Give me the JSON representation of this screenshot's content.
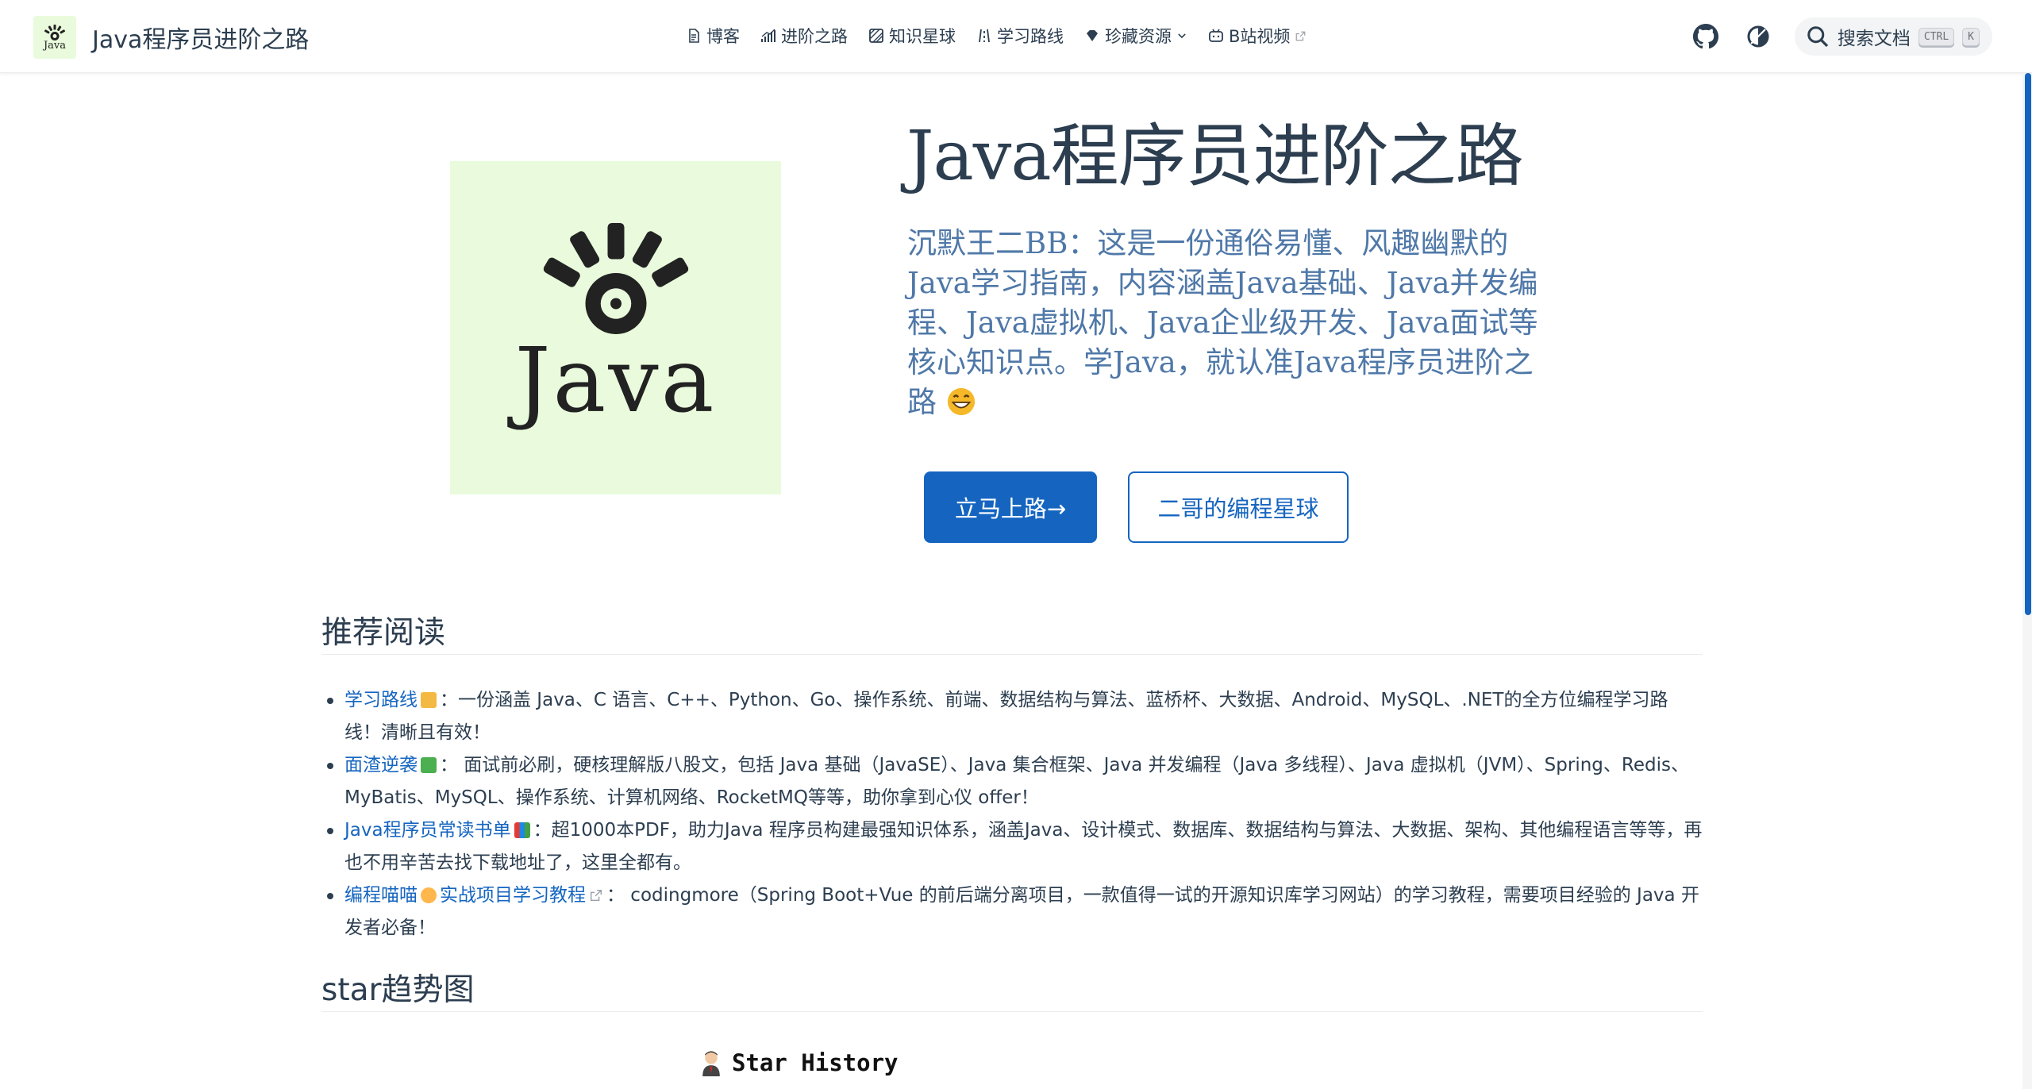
{
  "navbar": {
    "brand_title": "Java程序员进阶之路",
    "brand_logo_text": "Java",
    "links": [
      {
        "label": "博客",
        "icon": "document-icon"
      },
      {
        "label": "进阶之路",
        "icon": "chart-icon"
      },
      {
        "label": "知识星球",
        "icon": "planet-icon"
      },
      {
        "label": "学习路线",
        "icon": "route-icon"
      },
      {
        "label": "珍藏资源",
        "icon": "diamond-icon"
      },
      {
        "label": "B站视频",
        "icon": "tv-icon"
      }
    ],
    "search_label": "搜索文档",
    "kbd_ctrl": "CTRL",
    "kbd_k": "K"
  },
  "hero": {
    "logo_text": "Java",
    "title": "Java程序员进阶之路",
    "description": "沉默王二BB：这是一份通俗易懂、风趣幽默的Java学习指南，内容涵盖Java基础、Java并发编程、Java虚拟机、Java企业级开发、Java面试等核心知识点。学Java，就认准Java程序员进阶之路",
    "primary_button": "立马上路→",
    "secondary_button": "二哥的编程星球"
  },
  "recommended": {
    "heading": "推荐阅读",
    "items": [
      {
        "link": "学习路线",
        "text": "：一份涵盖 Java、C 语言、C++、Python、Go、操作系统、前端、数据结构与算法、蓝桥杯、大数据、Android、MySQL、.NET的全方位编程学习路线！清晰且有效！"
      },
      {
        "link": "面渣逆袭",
        "text": "： 面试前必刷，硬核理解版八股文，包括 Java 基础（JavaSE）、Java 集合框架、Java 并发编程（Java 多线程）、Java 虚拟机（JVM）、Spring、Redis、MyBatis、MySQL、操作系统、计算机网络、RocketMQ等等，助你拿到心仪 offer！"
      },
      {
        "link": "Java程序员常读书单",
        "text": "：超1000本PDF，助力Java 程序员构建最强知识体系，涵盖Java、设计模式、数据库、数据结构与算法、大数据、架构、其他编程语言等等，再也不用辛苦去找下载地址了，这里全都有。"
      },
      {
        "link": "编程喵喵",
        "link2": "实战项目学习教程",
        "text": "： codingmore（Spring Boot+Vue 的前后端分离项目，一款值得一试的开源知识库学习网站）的学习教程，需要项目经验的 Java 开发者必备！"
      }
    ]
  },
  "star_section": {
    "heading": "star趋势图",
    "chart_title": "Star History"
  },
  "colors": {
    "accent": "#1565c0",
    "text": "#2c3e50",
    "desc": "#4f78a8",
    "logo_bg": "#e9fbdc"
  }
}
